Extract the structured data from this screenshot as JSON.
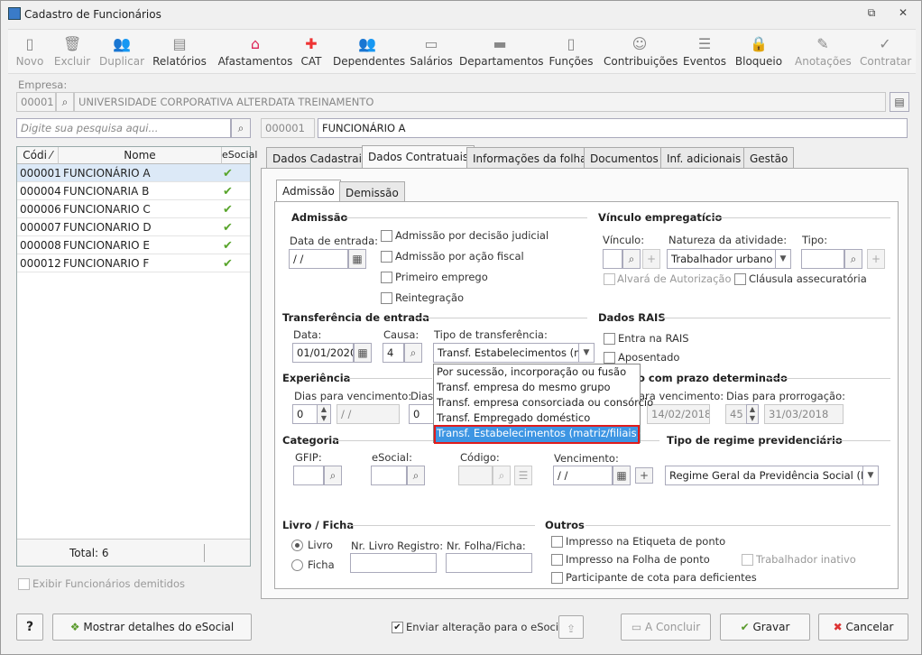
{
  "window": {
    "title": "Cadastro de Funcionários"
  },
  "toolbar": [
    {
      "label": "Novo",
      "icon": "new-doc-icon",
      "enabled": false
    },
    {
      "label": "Excluir",
      "icon": "trash-icon",
      "enabled": false
    },
    {
      "label": "Duplicar",
      "icon": "duplicate-users-icon",
      "enabled": false
    },
    {
      "label": "Relatórios",
      "icon": "report-icon",
      "enabled": true
    },
    {
      "label": "Afastamentos",
      "icon": "house-arrow-icon",
      "enabled": true
    },
    {
      "label": "CAT",
      "icon": "red-cross-icon",
      "enabled": true
    },
    {
      "label": "Dependentes",
      "icon": "people-icon",
      "enabled": true
    },
    {
      "label": "Salários",
      "icon": "money-icon",
      "enabled": true
    },
    {
      "label": "Departamentos",
      "icon": "desk-icon",
      "enabled": true
    },
    {
      "label": "Funções",
      "icon": "badge-icon",
      "enabled": true
    },
    {
      "label": "Contribuições",
      "icon": "contribution-icon",
      "enabled": true
    },
    {
      "label": "Eventos",
      "icon": "list-icon",
      "enabled": true
    },
    {
      "label": "Bloqueio",
      "icon": "lock-icon",
      "enabled": true
    },
    {
      "label": "Anotações",
      "icon": "notes-icon",
      "enabled": false
    },
    {
      "label": "Contratar",
      "icon": "hire-icon",
      "enabled": false
    }
  ],
  "empresa": {
    "label": "Empresa:",
    "code": "00001",
    "name": "UNIVERSIDADE CORPORATIVA ALTERDATA TREINAMENTO"
  },
  "search": {
    "placeholder": "Digite sua pesquisa aqui..."
  },
  "current": {
    "code": "000001",
    "name": "FUNCIONÁRIO A"
  },
  "grid": {
    "headers": {
      "code": "Códi",
      "name": "Nome",
      "esocial": "eSocial"
    },
    "rows": [
      {
        "code": "000001",
        "name": "FUNCIONÁRIO A",
        "esocial": "✔"
      },
      {
        "code": "000004",
        "name": "FUNCIONARIA B",
        "esocial": "✔"
      },
      {
        "code": "000006",
        "name": "FUNCIONARIO C",
        "esocial": "✔"
      },
      {
        "code": "000007",
        "name": "FUNCIONARIO D",
        "esocial": "✔"
      },
      {
        "code": "000008",
        "name": "FUNCIONARIO E",
        "esocial": "✔"
      },
      {
        "code": "000012",
        "name": "FUNCIONARIO F",
        "esocial": "✔"
      }
    ],
    "total": "Total: 6"
  },
  "show_dismissed": "Exibir Funcionários demitidos",
  "tabs": [
    "Dados Cadastrais",
    "Dados Contratuais",
    "Informações da folha",
    "Documentos",
    "Inf. adicionais",
    "Gestão"
  ],
  "subtabs": [
    "Admissão",
    "Demissão"
  ],
  "admissao": {
    "title": "Admissão",
    "data_label": "Data de entrada:",
    "data_value": " / /",
    "checks": [
      "Admissão por decisão judicial",
      "Admissão por ação fiscal",
      "Primeiro emprego",
      "Reintegração"
    ]
  },
  "vinculo": {
    "title": "Vínculo empregatício",
    "vinculo_label": "Vínculo:",
    "natureza_label": "Natureza da atividade:",
    "natureza_value": "Trabalhador urbano",
    "tipo_label": "Tipo:",
    "alvara": "Alvará de Autorização",
    "clausula": "Cláusula assecuratória"
  },
  "transf": {
    "title": "Transferência de entrada",
    "data_label": "Data:",
    "data_value": "01/01/2020",
    "causa_label": "Causa:",
    "causa_value": "4",
    "tipo_label": "Tipo de transferência:",
    "tipo_value": "Transf. Estabelecimentos (ma",
    "options": [
      "Por sucessão, incorporação ou fusão",
      "Transf. empresa do mesmo grupo",
      "Transf. empresa consorciada ou consórcio",
      "Transf. Empregado doméstico",
      "Transf. Estabelecimentos (matriz/filiais)"
    ]
  },
  "rais": {
    "title": "Dados RAIS",
    "entra": "Entra na RAIS",
    "aposentado": "Aposentado"
  },
  "experiencia": {
    "title": "Experiência",
    "dias_label": "Dias para vencimento:",
    "dias_value": "0",
    "date_value": " / /",
    "dias2_label": "Dias",
    "dias2_value": "0"
  },
  "prazo": {
    "title": "o com prazo determinado",
    "venc_label": "ara vencimento:",
    "venc_value": "14/02/2018",
    "prorr_label": "Dias para prorrogação:",
    "prorr_days": "45",
    "prorr_date": "31/03/2018"
  },
  "categoria": {
    "title": "Categoria",
    "gfip": "GFIP:",
    "esocial": "eSocial:",
    "codigo": "Código:",
    "venc": "Vencimento:",
    "venc_value": " / /"
  },
  "regime": {
    "title": "Tipo de regime previdenciário",
    "value": "Regime Geral da Previdência Social (RGP"
  },
  "livro": {
    "title": "Livro / Ficha",
    "opt1": "Livro",
    "opt2": "Ficha",
    "nr_livro": "Nr. Livro Registro:",
    "nr_folha": "Nr. Folha/Ficha:"
  },
  "outros": {
    "title": "Outros",
    "items": [
      "Impresso na Etiqueta de ponto",
      "Impresso na Folha de ponto",
      "Participante de cota para deficientes"
    ],
    "inativo": "Trabalhador inativo"
  },
  "footer": {
    "help": "?",
    "detalhes": "Mostrar detalhes do eSocial",
    "enviar": "Enviar alteração para o eSocial",
    "concluir": "A Concluir",
    "gravar": "Gravar",
    "cancelar": "Cancelar"
  }
}
